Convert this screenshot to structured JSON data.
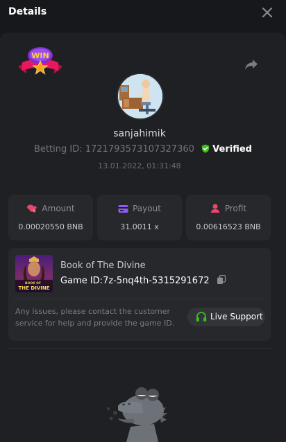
{
  "header": {
    "title": "Details"
  },
  "bet": {
    "username": "sanjahimik",
    "betting_id_label": "Betting ID:",
    "betting_id": "1721793573107327360",
    "verified_label": "Verified",
    "timestamp": "13.01.2022, 01:31:48"
  },
  "stats": [
    {
      "label": "Amount",
      "value": "0.00020550 BNB",
      "icon": "coins-icon",
      "color": "#e8466a"
    },
    {
      "label": "Payout",
      "value": "31.0011 x",
      "icon": "card-icon",
      "color": "#8b5cf6"
    },
    {
      "label": "Profit",
      "value": "0.00616523 BNB",
      "icon": "user-profit-icon",
      "color": "#e8466a"
    }
  ],
  "game": {
    "name": "Book of The Divine",
    "id_label": "Game ID:",
    "id": "7z-5nq4th-5315291672",
    "thumb_text_1": "BOOK OF",
    "thumb_text_2": "THE DIVINE"
  },
  "support": {
    "text": "Any issues, please contact the customer service for help and provide the game ID.",
    "button_label": "Live Support"
  },
  "badge": {
    "text": "WIN"
  },
  "colors": {
    "background": "#17181b",
    "card": "#27282c",
    "verified": "#3bc117",
    "support_icon": "#3bc117"
  }
}
